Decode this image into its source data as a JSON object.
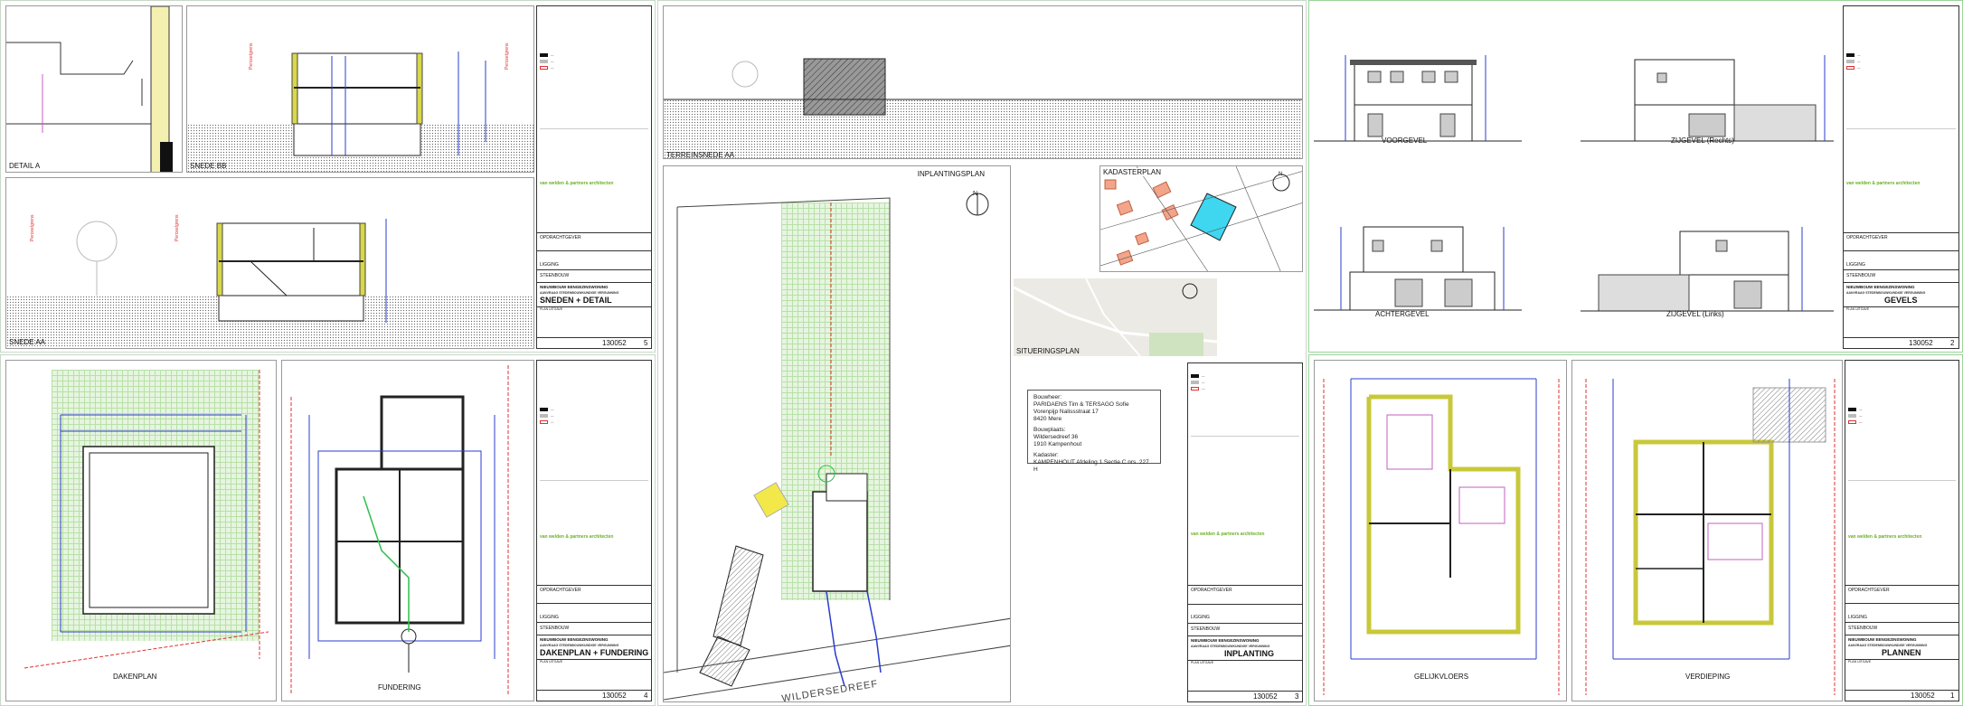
{
  "sheets": {
    "s5": {
      "panels": {
        "detail": "DETAIL A",
        "snede_bb": "SNEDE BB",
        "snede_aa": "SNEDE AA"
      },
      "title": "SNEDEN + DETAIL",
      "number": "5"
    },
    "s3": {
      "panels": {
        "terrein": "TERREINSNEDE AA",
        "inplanting": "INPLANTINGSPLAN",
        "kadaster": "KADASTERPLAN",
        "situering": "SITUERINGSPLAN"
      },
      "title": "INPLANTING",
      "number": "3",
      "street": "WILDERSEDREEF"
    },
    "s4": {
      "panels": {
        "dakenplan": "DAKENPLAN",
        "fundering": "FUNDERING"
      },
      "title": "DAKENPLAN + FUNDERING",
      "number": "4"
    },
    "s2": {
      "panels": {
        "voorgevel": "VOORGEVEL",
        "zij_rechts": "ZIJGEVEL (Rechts)",
        "achtergevel": "ACHTERGEVEL",
        "zij_links": "ZIJGEVEL (Links)"
      },
      "title": "GEVELS",
      "number": "2"
    },
    "s1": {
      "panels": {
        "gelijkvloers": "GELIJKVLOERS",
        "verdieping": "VERDIEPING"
      },
      "title": "PLANNEN",
      "number": "1"
    }
  },
  "titleblock": {
    "firm": "van welden & partners architecten",
    "opdrachtgever": "OPDRACHTGEVER",
    "ligging": "LIGGING",
    "steenbouw": "STEENBOUW",
    "project": "NIEUWBOUW EENGEZINSWONING",
    "aanvraag": "AANVRAAG STEDENBOUWKUNDIGE VERGUNNING",
    "plan_uitgave": "PLAN UITGAVE",
    "schaal": "SCHAAL INDICATIE",
    "dossier": "130052"
  },
  "address": {
    "bouwheer_label": "Bouwheer:",
    "bouwheer_name": "PARIDAENS Tim & TERSAGO Sofie",
    "bouwheer_street": "Vorenpijp Nalissstraat 17",
    "bouwheer_city": "8420 Mere",
    "bouwplaats_label": "Bouwplaats:",
    "bouwplaats_street": "Wildersedreef 36",
    "bouwplaats_city": "1910 Kampenhout",
    "kadaster_label": "Kadaster:",
    "kadaster_value": "KAMPENHOUT Afdeling 1 Sectie C nrs. 227 H"
  },
  "colors": {
    "drawing_blue": "#2a3ccf",
    "annotation_red": "#e03030",
    "wall_yellow": "#d8d84a",
    "grass_green": "#b8e0a8",
    "firm_green": "#6ab023",
    "kadaster_cyan": "#3fd6f0"
  }
}
